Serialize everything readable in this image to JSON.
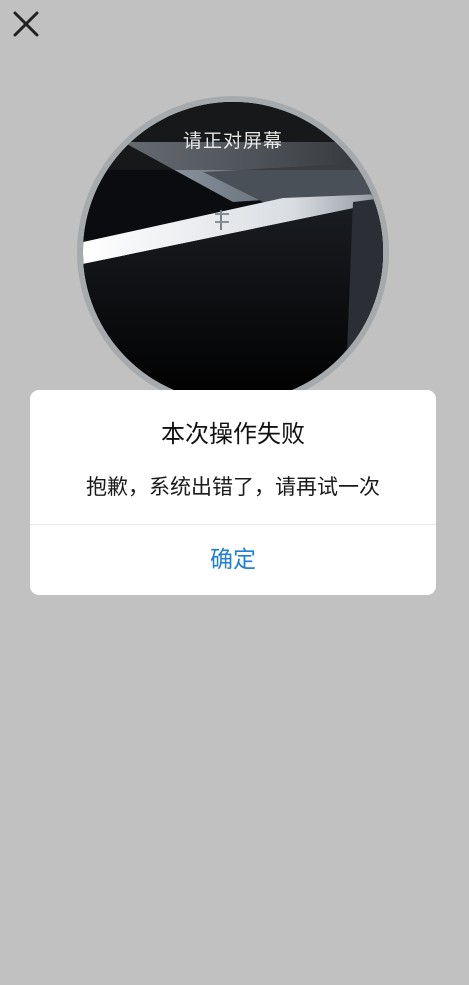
{
  "close_icon": "close-icon",
  "camera": {
    "hint": "请正对屏幕"
  },
  "dialog": {
    "title": "本次操作失败",
    "message": "抱歉，系统出错了，请再试一次",
    "confirm_label": "确定",
    "confirm_color": "#1f7fd6"
  },
  "colors": {
    "background": "#c1c1c1",
    "dialog_background": "#ffffff"
  }
}
